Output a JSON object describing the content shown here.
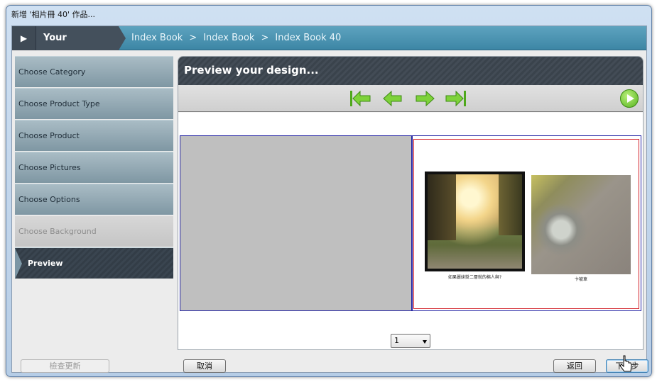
{
  "window": {
    "title": "新增 '相片冊 40' 作品..."
  },
  "breadcrumb": {
    "label": "Your Selections:",
    "items": [
      "Index Book",
      "Index Book",
      "Index Book 40"
    ],
    "separator": ">"
  },
  "nav": {
    "items": [
      {
        "label": "Choose Category",
        "state": "normal"
      },
      {
        "label": "Choose Product Type",
        "state": "normal"
      },
      {
        "label": "Choose Product",
        "state": "normal"
      },
      {
        "label": "Choose Pictures",
        "state": "normal"
      },
      {
        "label": "Choose Options",
        "state": "normal"
      },
      {
        "label": "Choose Background",
        "state": "disabled"
      },
      {
        "label": "Preview",
        "state": "active"
      }
    ]
  },
  "main": {
    "title": "Preview your design...",
    "toolbar": {
      "first_icon": "first-page-icon",
      "prev_icon": "prev-page-icon",
      "next_icon": "next-page-icon",
      "last_icon": "last-page-icon",
      "play_icon": "play-icon"
    },
    "photos": [
      {
        "caption": "如果麗妹掛二層就的棉人與?"
      },
      {
        "caption": "卞被車"
      }
    ],
    "page_select": {
      "value": "1"
    }
  },
  "footer": {
    "check_update": "檢查更新",
    "cancel": "取消",
    "back": "返回",
    "next": "下一步"
  },
  "colors": {
    "breadcrumb": "#4a93b1",
    "nav_active": "#3a4550",
    "accent_green": "#56b31f",
    "page_border": "#2525a5",
    "page_inner_border": "#d3232b"
  }
}
